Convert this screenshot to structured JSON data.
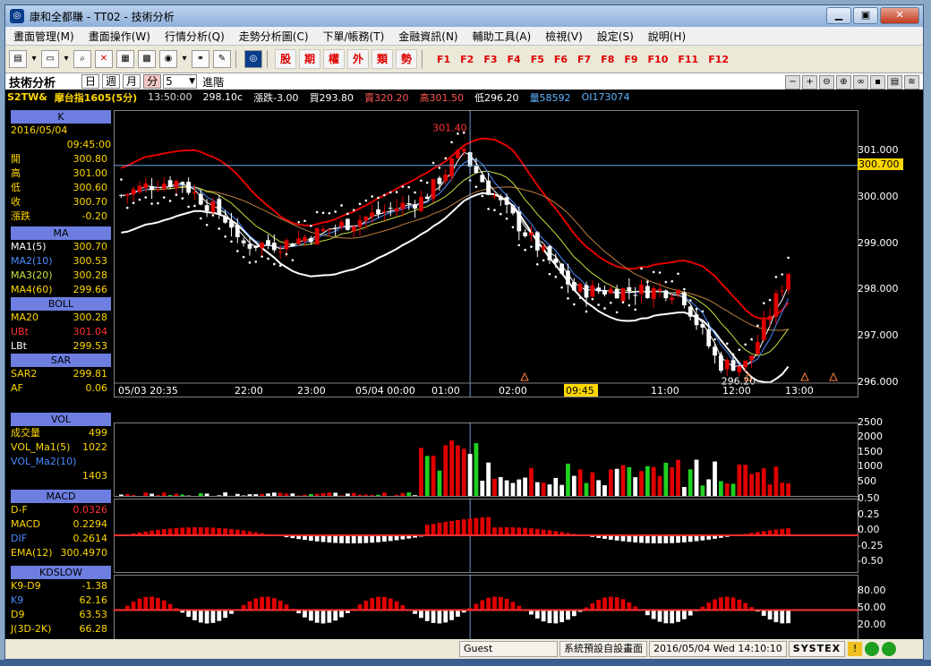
{
  "window": {
    "title": "康和全都賺 - TT02 - 技術分析",
    "icon": "app-logo-icon"
  },
  "menu": [
    "畫面管理(M)",
    "畫面操作(W)",
    "行情分析(Q)",
    "走勢分析圖(C)",
    "下單/帳務(T)",
    "金融資訊(N)",
    "輔助工具(A)",
    "檢視(V)",
    "設定(S)",
    "說明(H)"
  ],
  "toolbar": {
    "funds": [
      "股",
      "期",
      "權",
      "外",
      "類",
      "勢"
    ],
    "fkeys": [
      "F1",
      "F2",
      "F3",
      "F4",
      "F5",
      "F6",
      "F7",
      "F8",
      "F9",
      "F10",
      "F11",
      "F12"
    ]
  },
  "tech": {
    "label": "技術分析",
    "periods": [
      "日",
      "週",
      "月",
      "分"
    ],
    "selected_period": "分",
    "minutes": "5",
    "advanced": "進階"
  },
  "quote": {
    "code": "S2TW&",
    "name": "摩台指1605(5分)",
    "time": "13:50:00",
    "price": "298.10c",
    "change": "漲跌-3.00",
    "bid": "買293.80",
    "ask": "賣320.20",
    "high": "高301.50",
    "low": "低296.20",
    "volume": "量58592",
    "oi": "OI173074"
  },
  "side": {
    "k": {
      "title": "K",
      "date": "2016/05/04",
      "time": "09:45:00",
      "rows": [
        [
          "開",
          "300.80"
        ],
        [
          "高",
          "301.00"
        ],
        [
          "低",
          "300.60"
        ],
        [
          "收",
          "300.70"
        ],
        [
          "漲跌",
          "-0.20"
        ]
      ]
    },
    "ma": {
      "title": "MA",
      "rows": [
        [
          "MA1(5)",
          "300.70"
        ],
        [
          "MA2(10)",
          "300.53"
        ],
        [
          "MA3(20)",
          "300.28"
        ],
        [
          "MA4(60)",
          "299.66"
        ]
      ]
    },
    "boll": {
      "title": "BOLL",
      "rows": [
        [
          "MA20",
          "300.28"
        ],
        [
          "UBt",
          "301.04"
        ],
        [
          "LBt",
          "299.53"
        ]
      ]
    },
    "sar": {
      "title": "SAR",
      "rows": [
        [
          "SAR2",
          "299.81"
        ],
        [
          "AF",
          "0.06"
        ]
      ]
    },
    "vol": {
      "title": "VOL",
      "rows": [
        [
          "成交量",
          "499"
        ],
        [
          "VOL_Ma1(5)",
          "1022"
        ],
        [
          "VOL_Ma2(10)",
          ""
        ],
        [
          "",
          "1403"
        ]
      ]
    },
    "macd": {
      "title": "MACD",
      "rows": [
        [
          "D-F",
          "0.0326"
        ],
        [
          "MACD",
          "0.2294"
        ],
        [
          "DIF",
          "0.2614"
        ],
        [
          "EMA(12)",
          "300.4970"
        ]
      ]
    },
    "kd": {
      "title": "KDSLOW",
      "rows": [
        [
          "K9-D9",
          "-1.38"
        ],
        [
          "K9",
          "62.16"
        ],
        [
          "D9",
          "63.53"
        ],
        [
          "J(3D-2K)",
          "66.28"
        ]
      ]
    }
  },
  "price_axis": [
    "301.000",
    "300.000",
    "299.000",
    "298.000",
    "297.000",
    "296.000"
  ],
  "cursor_price": "300.700",
  "hi_label": "301.40",
  "lo_label": "296.20",
  "time_axis": [
    "05/03 20:35",
    "22:00",
    "23:00",
    "05/04 00:00",
    "01:00",
    "02:00",
    "09:45",
    "11:00",
    "12:00",
    "13:00"
  ],
  "vol_axis": [
    "2500",
    "2000",
    "1500",
    "1000",
    "500"
  ],
  "macd_axis": [
    "0.50",
    "0.25",
    "0.00",
    "-0.25",
    "-0.50"
  ],
  "kd_axis": [
    "80.00",
    "50.00",
    "20.00"
  ],
  "status": {
    "user": "Guest",
    "layout": "系統預設自設畫面",
    "datetime": "2016/05/04 Wed 14:10:10",
    "brand": "SYSTEX"
  },
  "colors": {
    "up": "#e00000",
    "down": "#ffffff",
    "boll": "#e00000",
    "ma1": "#ffffff",
    "ma2": "#4a8cff",
    "ma3": "#c8e040",
    "ma4": "#c08040",
    "cursor": "#ffd700"
  }
}
